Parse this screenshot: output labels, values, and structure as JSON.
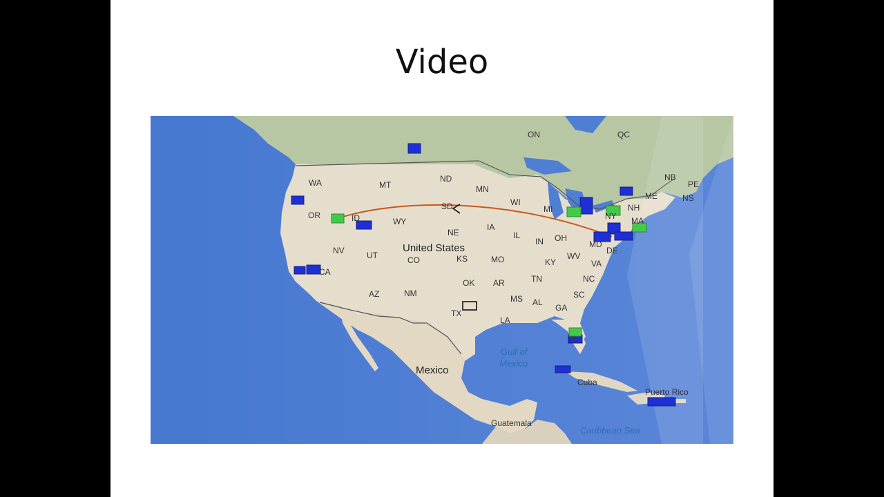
{
  "slide": {
    "title": "Video"
  },
  "map": {
    "country_labels": {
      "united_states": "United States",
      "mexico": "Mexico",
      "cuba": "Cuba",
      "puerto_rico": "Puerto Rico",
      "guatemala": "Guatemala"
    },
    "water_labels": {
      "gulf_line1": "Gulf of",
      "gulf_line2": "Mexico",
      "caribbean": "Caribbean Sea"
    },
    "region_labels": {
      "on": "ON",
      "qc": "QC",
      "nb": "NB",
      "pe": "PE",
      "ns": "NS",
      "wa": "WA",
      "mt": "MT",
      "nd": "ND",
      "mn": "MN",
      "or": "OR",
      "id": "ID",
      "wy": "WY",
      "sd": "SD",
      "wi": "WI",
      "mi": "MI",
      "ny": "NY",
      "nh": "NH",
      "me": "ME",
      "ma": "MA",
      "ne": "NE",
      "ia": "IA",
      "il": "IL",
      "in": "IN",
      "oh": "OH",
      "nv": "NV",
      "ut": "UT",
      "co": "CO",
      "ks": "KS",
      "mo": "MO",
      "ky": "KY",
      "wv": "WV",
      "va": "VA",
      "md": "MD",
      "de": "DE",
      "ca": "CA",
      "az": "AZ",
      "nm": "NM",
      "ok": "OK",
      "ar": "AR",
      "tn": "TN",
      "nc": "NC",
      "sc": "SC",
      "ms": "MS",
      "al": "AL",
      "ga": "GA",
      "tx": "TX",
      "la": "LA",
      "fl": "FL"
    },
    "colors": {
      "ocean": "#4a7ad1",
      "land": "#e7dfcf",
      "forest": "#b9c9a6",
      "marker_blue": "#1f2fd6",
      "marker_green": "#45c94a",
      "track": "#c8571c"
    }
  }
}
